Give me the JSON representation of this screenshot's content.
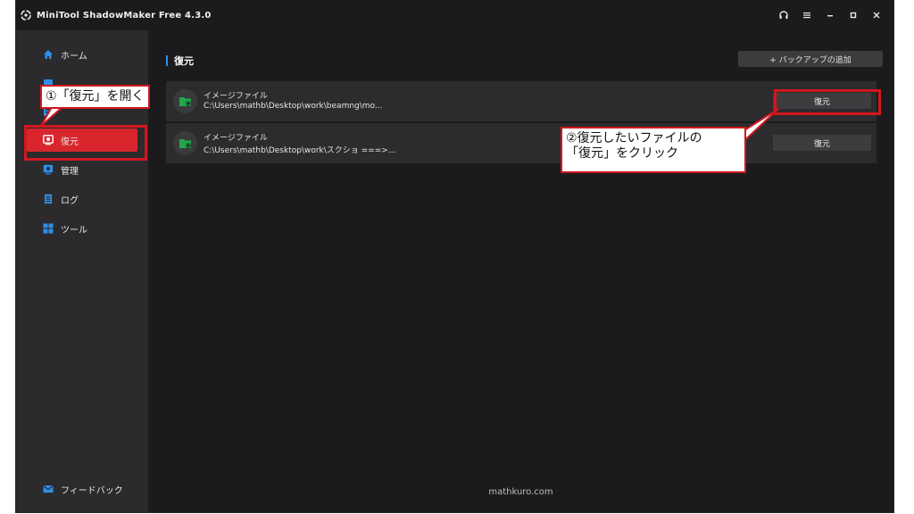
{
  "app": {
    "title": "MiniTool ShadowMaker Free 4.3.0"
  },
  "window_controls": [
    "headset-icon",
    "menu-icon",
    "minimize-icon",
    "maximize-icon",
    "close-icon"
  ],
  "sidebar": {
    "items": [
      {
        "label": "ホーム",
        "icon": "home-icon"
      },
      {
        "label": "",
        "icon": "backup-icon"
      },
      {
        "label": "",
        "icon": "sync-icon"
      },
      {
        "label": "復元",
        "icon": "restore-icon",
        "active": true
      },
      {
        "label": "管理",
        "icon": "manage-icon"
      },
      {
        "label": "ログ",
        "icon": "log-icon"
      },
      {
        "label": "ツール",
        "icon": "tools-icon"
      }
    ],
    "feedback": "フィードバック"
  },
  "main": {
    "title": "復元",
    "add_backup": "+ バックアップの追加",
    "backups": [
      {
        "name": "イメージファイル",
        "path": "C:\\Users\\mathb\\Desktop\\work\\beamng\\mo...",
        "action": "復元"
      },
      {
        "name": "イメージファイル",
        "path": "C:\\Users\\mathb\\Desktop\\work\\スクショ ===>...",
        "action": "復元"
      }
    ],
    "watermark": "mathkuro.com"
  },
  "annotations": {
    "callout1": "①「復元」を開く",
    "callout2_line1": "②復元したいファイルの",
    "callout2_line2": "「復元」をクリック"
  },
  "colors": {
    "accent_red": "#d8262c",
    "annotation_red": "#d0171f",
    "accent_blue": "#2f8fe8",
    "folder_green": "#22a84a"
  }
}
